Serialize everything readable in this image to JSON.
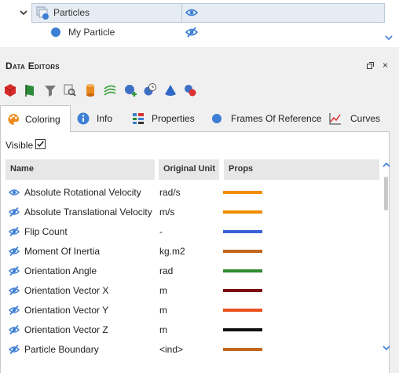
{
  "tree": {
    "rows": [
      {
        "label": "Particles",
        "expanded": true,
        "selected": true,
        "icon": "particles-group-icon",
        "eye": "visible"
      },
      {
        "label": "My Particle",
        "icon": "particle-dot-icon",
        "eye": "hidden"
      }
    ]
  },
  "editors": {
    "title": "Data Editors",
    "close_label": "×",
    "toolbar": [
      "cube-red-icon",
      "flag-green-icon",
      "filter-icon",
      "search-doc-icon",
      "cylinder-orange-icon",
      "stripes-green-icon",
      "add-sphere-icon",
      "clock-sphere-icon",
      "cone-blue-icon",
      "sphere-pair-icon"
    ],
    "tabs": [
      {
        "label": "Coloring",
        "icon": "palette-icon",
        "active": true
      },
      {
        "label": "Info",
        "icon": "info-icon",
        "active": false
      },
      {
        "label": "Properties",
        "icon": "properties-icon",
        "active": false
      },
      {
        "label": "Frames Of Reference",
        "icon": "frame-sphere-icon",
        "active": false
      },
      {
        "label": "Curves",
        "icon": "curves-chart-icon",
        "active": false
      }
    ],
    "visible_label": "Visible",
    "visible_checked": true,
    "columns": [
      "Name",
      "Original Unit",
      "Props"
    ],
    "rows": [
      {
        "name": "Absolute Rotational Velocity",
        "unit": "rad/s",
        "color": "#f08c00",
        "eye": "visible"
      },
      {
        "name": "Absolute Translational Velocity",
        "unit": "m/s",
        "color": "#f08c00",
        "eye": "hidden"
      },
      {
        "name": "Flip Count",
        "unit": "-",
        "color": "#3a62d8",
        "eye": "hidden"
      },
      {
        "name": "Moment Of Inertia",
        "unit": "kg.m2",
        "color": "#c0661f",
        "eye": "hidden"
      },
      {
        "name": "Orientation Angle",
        "unit": "rad",
        "color": "#2e8b2e",
        "eye": "hidden"
      },
      {
        "name": "Orientation Vector X",
        "unit": "m",
        "color": "#7a1010",
        "eye": "hidden"
      },
      {
        "name": "Orientation Vector Y",
        "unit": "m",
        "color": "#e8501a",
        "eye": "hidden"
      },
      {
        "name": "Orientation Vector Z",
        "unit": "m",
        "color": "#111111",
        "eye": "hidden"
      },
      {
        "name": "Particle Boundary",
        "unit": "<ind>",
        "color": "#c0661f",
        "eye": "hidden"
      }
    ]
  },
  "colors": {
    "accent": "#3d7fd4",
    "selection": "#e6ecf3"
  }
}
